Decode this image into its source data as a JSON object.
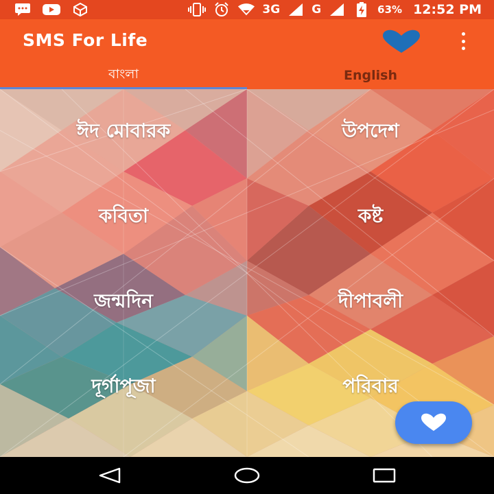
{
  "status_bar": {
    "battery": "63%",
    "time": "12:52 PM",
    "network_1": "3G",
    "network_2": "G",
    "icons": [
      "message-icon",
      "youtube-icon",
      "package-icon",
      "vibrate-icon",
      "alarm-icon",
      "wifi-icon",
      "signal-icon",
      "battery-charging-icon"
    ]
  },
  "app_bar": {
    "title": "SMS For Life",
    "favorite_icon": "heart-icon",
    "menu_icon": "overflow-menu-icon",
    "colors": {
      "primary": "#f45a24",
      "status": "#e4471f",
      "heart": "#1f6fb8"
    }
  },
  "tabs": [
    {
      "label": "বাংলা",
      "selected": true
    },
    {
      "label": "English",
      "selected": false
    }
  ],
  "categories": [
    "ঈদ মোবারক",
    "উপদেশ",
    "কবিতা",
    "কষ্ট",
    "জন্মদিন",
    "দীপাবলী",
    "দূর্গাপূজা",
    "পরিবার"
  ],
  "fab": {
    "icon": "heart-icon",
    "color": "#4a87f0"
  },
  "nav_bar": {
    "icons": [
      "back-icon",
      "home-icon",
      "recents-icon"
    ]
  }
}
